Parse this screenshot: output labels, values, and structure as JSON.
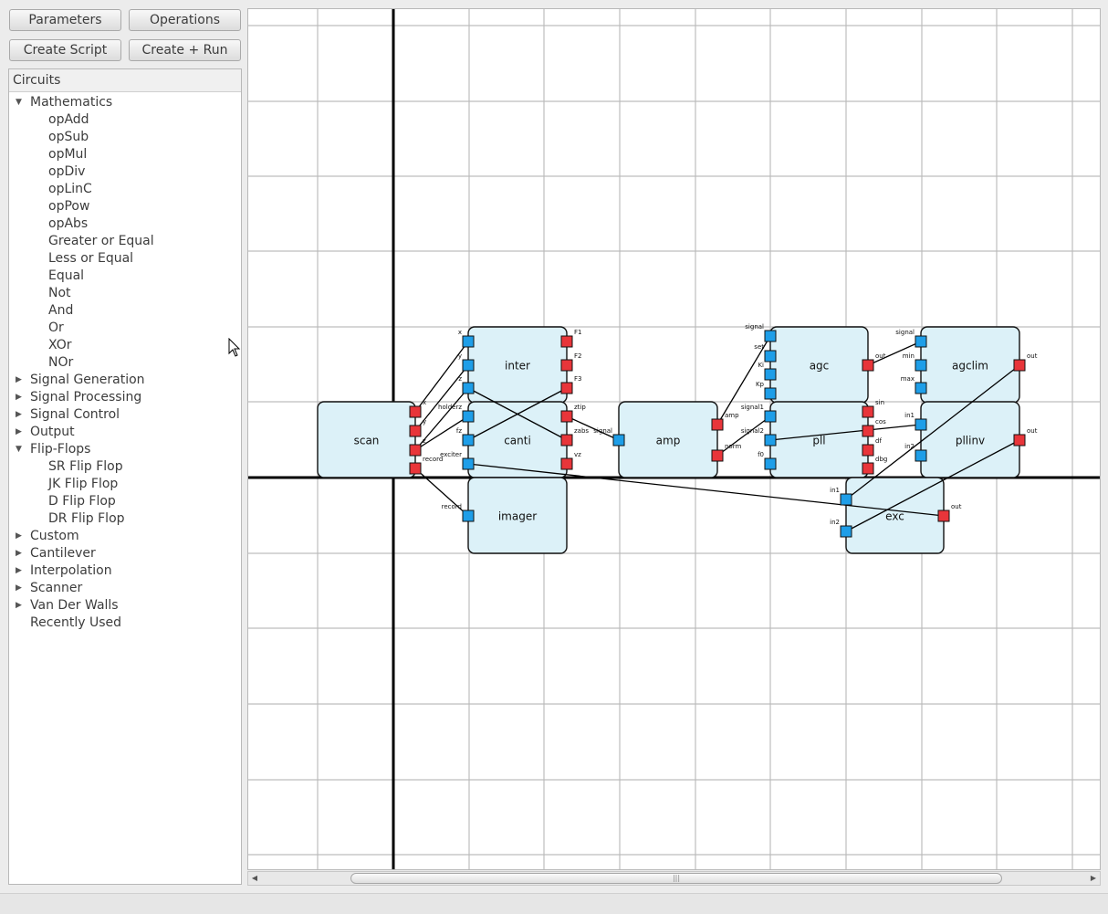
{
  "toolbar": {
    "parameters": "Parameters",
    "operations": "Operations",
    "create_script": "Create Script",
    "create_run": "Create + Run"
  },
  "tree": {
    "header": "Circuits",
    "rows": [
      {
        "label": "Mathematics",
        "level": 0,
        "expander": "expanded"
      },
      {
        "label": "opAdd",
        "level": 1,
        "expander": "none"
      },
      {
        "label": "opSub",
        "level": 1,
        "expander": "none"
      },
      {
        "label": "opMul",
        "level": 1,
        "expander": "none"
      },
      {
        "label": "opDiv",
        "level": 1,
        "expander": "none"
      },
      {
        "label": "opLinC",
        "level": 1,
        "expander": "none"
      },
      {
        "label": "opPow",
        "level": 1,
        "expander": "none"
      },
      {
        "label": "opAbs",
        "level": 1,
        "expander": "none"
      },
      {
        "label": "Greater or Equal",
        "level": 1,
        "expander": "none"
      },
      {
        "label": "Less or Equal",
        "level": 1,
        "expander": "none"
      },
      {
        "label": "Equal",
        "level": 1,
        "expander": "none"
      },
      {
        "label": "Not",
        "level": 1,
        "expander": "none"
      },
      {
        "label": "And",
        "level": 1,
        "expander": "none"
      },
      {
        "label": "Or",
        "level": 1,
        "expander": "none"
      },
      {
        "label": "XOr",
        "level": 1,
        "expander": "none"
      },
      {
        "label": "NOr",
        "level": 1,
        "expander": "none"
      },
      {
        "label": "Signal Generation",
        "level": 0,
        "expander": "collapsed"
      },
      {
        "label": "Signal Processing",
        "level": 0,
        "expander": "collapsed"
      },
      {
        "label": "Signal Control",
        "level": 0,
        "expander": "collapsed"
      },
      {
        "label": "Output",
        "level": 0,
        "expander": "collapsed"
      },
      {
        "label": "Flip-Flops",
        "level": 0,
        "expander": "expanded"
      },
      {
        "label": "SR Flip Flop",
        "level": 1,
        "expander": "none"
      },
      {
        "label": "JK Flip Flop",
        "level": 1,
        "expander": "none"
      },
      {
        "label": "D Flip Flop",
        "level": 1,
        "expander": "none"
      },
      {
        "label": "DR Flip Flop",
        "level": 1,
        "expander": "none"
      },
      {
        "label": "Custom",
        "level": 0,
        "expander": "collapsed"
      },
      {
        "label": "Cantilever",
        "level": 0,
        "expander": "collapsed"
      },
      {
        "label": "Interpolation",
        "level": 0,
        "expander": "collapsed"
      },
      {
        "label": "Scanner",
        "level": 0,
        "expander": "collapsed"
      },
      {
        "label": "Van Der Walls",
        "level": 0,
        "expander": "collapsed"
      },
      {
        "label": "Recently Used",
        "level": 0,
        "expander": "none"
      }
    ]
  },
  "colors": {
    "block_fill": "#dcf1f8",
    "input_port": "#1e9ee8",
    "output_port": "#e8353a",
    "grid": "#bdbdbd",
    "axis": "#000000"
  },
  "circuit": {
    "blocks": [
      {
        "name": "scan",
        "inputs": [],
        "outputs": [
          "x",
          "y",
          "z",
          "record"
        ]
      },
      {
        "name": "inter",
        "inputs": [
          "x",
          "y",
          "z"
        ],
        "outputs": [
          "F1",
          "F2",
          "F3"
        ]
      },
      {
        "name": "canti",
        "inputs": [
          "holderz",
          "fz",
          "exciter"
        ],
        "outputs": [
          "ztip",
          "zabs",
          "vz"
        ]
      },
      {
        "name": "amp",
        "inputs": [
          "signal"
        ],
        "outputs": [
          "amp",
          "norm"
        ]
      },
      {
        "name": "agc",
        "inputs": [
          "signal",
          "set",
          "Ki",
          "Kp"
        ],
        "outputs": [
          "out"
        ]
      },
      {
        "name": "agclim",
        "inputs": [
          "signal",
          "min",
          "max"
        ],
        "outputs": [
          "out"
        ]
      },
      {
        "name": "pll",
        "inputs": [
          "signal1",
          "signal2",
          "f0"
        ],
        "outputs": [
          "sin",
          "cos",
          "df",
          "dbg"
        ]
      },
      {
        "name": "pllinv",
        "inputs": [
          "in1",
          "in2"
        ],
        "outputs": [
          "out"
        ]
      },
      {
        "name": "imager",
        "inputs": [
          "record"
        ],
        "outputs": []
      },
      {
        "name": "exc",
        "inputs": [
          "in1",
          "in2"
        ],
        "outputs": [
          "out"
        ]
      }
    ],
    "wires": [
      {
        "from": "scan.x",
        "to": "inter.x"
      },
      {
        "from": "scan.y",
        "to": "inter.y"
      },
      {
        "from": "scan.z",
        "to": "inter.z"
      },
      {
        "from": "scan.z",
        "to": "canti.holderz"
      },
      {
        "from": "scan.record",
        "to": "imager.record"
      },
      {
        "from": "inter.F3",
        "to": "canti.fz"
      },
      {
        "from": "inter.z",
        "to": "canti.zabs"
      },
      {
        "from": "canti.ztip",
        "to": "amp.signal"
      },
      {
        "from": "amp.amp",
        "to": "agc.signal"
      },
      {
        "from": "amp.norm",
        "to": "pll.signal1"
      },
      {
        "from": "agc.out",
        "to": "agclim.signal"
      },
      {
        "from": "pll.signal2",
        "to": "pllinv.in1"
      },
      {
        "from": "agclim.out",
        "to": "exc.in1"
      },
      {
        "from": "pllinv.out",
        "to": "exc.in2"
      },
      {
        "from": "canti.exciter",
        "to": "exc.out"
      }
    ]
  }
}
